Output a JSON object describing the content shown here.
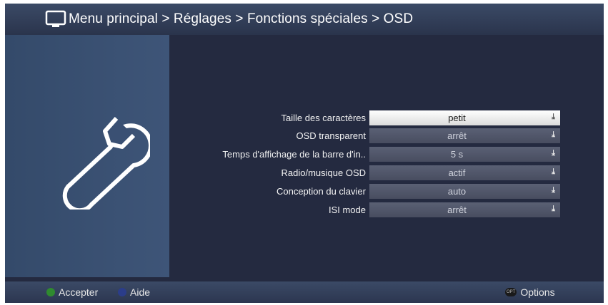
{
  "header": {
    "breadcrumb": "Menu principal > Réglages > Fonctions spéciales > OSD",
    "icon": "tv-icon"
  },
  "sidebar": {
    "icon": "wrench-icon"
  },
  "settings": [
    {
      "label": "Taille des caractères",
      "value": "petit",
      "selected": true
    },
    {
      "label": "OSD transparent",
      "value": "arrêt",
      "selected": false
    },
    {
      "label": "Temps d'affichage de la barre d'in..",
      "value": "5 s",
      "selected": false
    },
    {
      "label": "Radio/musique OSD",
      "value": "actif",
      "selected": false
    },
    {
      "label": "Conception du clavier",
      "value": "auto",
      "selected": false
    },
    {
      "label": "ISI mode",
      "value": "arrêt",
      "selected": false
    }
  ],
  "footer": {
    "accept": {
      "label": "Accepter",
      "color": "#2f8a2f"
    },
    "help": {
      "label": "Aide",
      "color": "#2b3d8a"
    },
    "options": {
      "badge": "OPT",
      "label": "Options"
    }
  },
  "colors": {
    "background": "#242a40",
    "header": "#33405c",
    "panel": "#3a5073",
    "selected_value": "#ffffff",
    "value_box": "#50566a"
  }
}
